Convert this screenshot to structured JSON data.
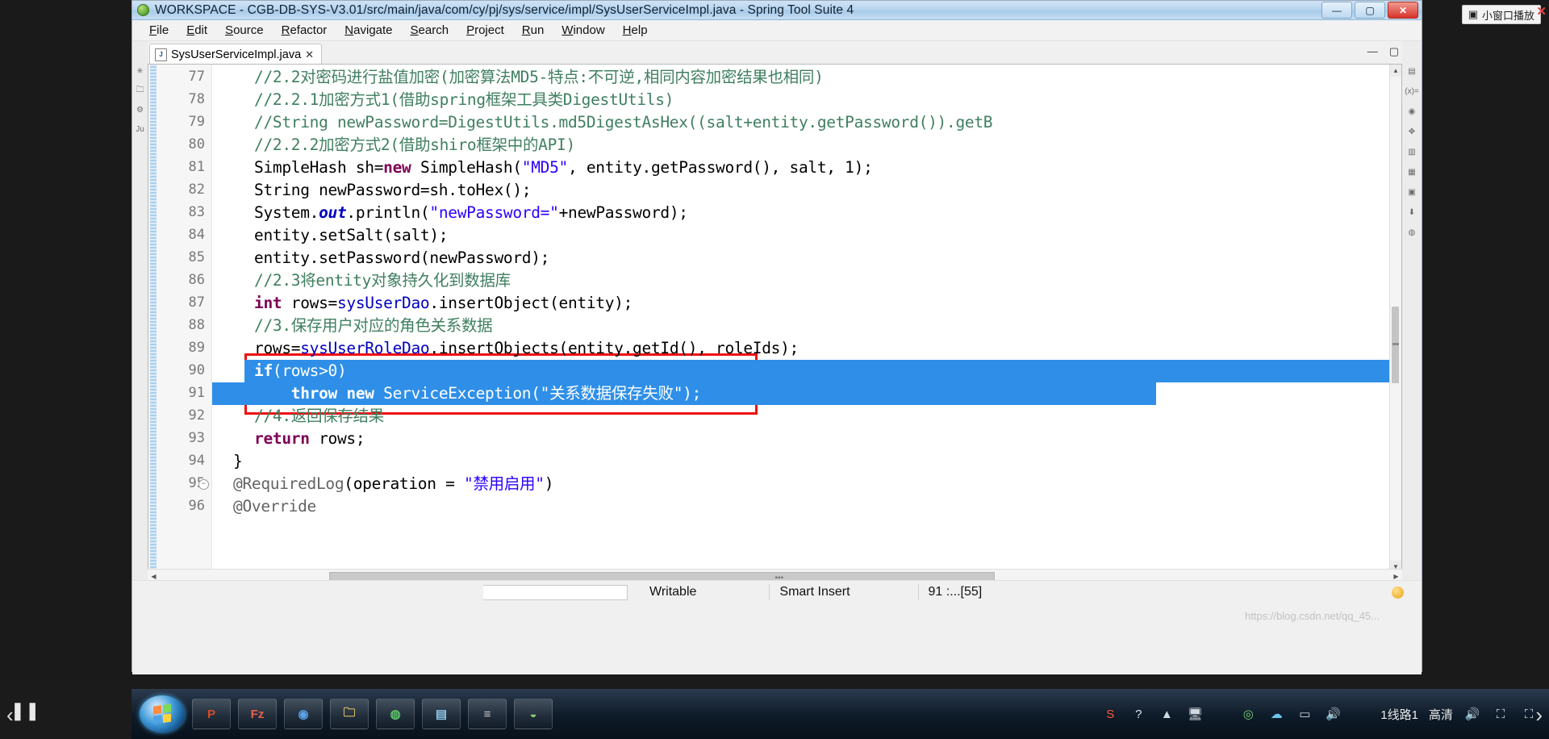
{
  "window": {
    "title": "WORKSPACE - CGB-DB-SYS-V3.01/src/main/java/com/cy/pj/sys/service/impl/SysUserServiceImpl.java - Spring Tool Suite 4",
    "minimize_label": "—",
    "maximize_label": "▢",
    "close_label": "✕"
  },
  "menu": {
    "items": [
      {
        "label": "File"
      },
      {
        "label": "Edit"
      },
      {
        "label": "Source"
      },
      {
        "label": "Refactor"
      },
      {
        "label": "Navigate"
      },
      {
        "label": "Search"
      },
      {
        "label": "Project"
      },
      {
        "label": "Run"
      },
      {
        "label": "Window"
      },
      {
        "label": "Help"
      }
    ]
  },
  "editor": {
    "tab": {
      "label": "SysUserServiceImpl.java",
      "icon": "java-file-icon",
      "icon_glyph": "J",
      "close_glyph": "✕"
    },
    "minimize_glyph": "—",
    "maximize_glyph": "▢",
    "first_line": 77,
    "lines": [
      {
        "no": "77",
        "tokens": [
          {
            "t": "//2.2对密码进行盐值加密(加密算法MD5-特点:不可逆,相同内容加密结果也相同)",
            "c": "cmt"
          }
        ]
      },
      {
        "no": "78",
        "tokens": [
          {
            "t": "//2.2.1加密方式1(借助spring框架工具类DigestUtils)",
            "c": "cmt"
          }
        ]
      },
      {
        "no": "79",
        "tokens": [
          {
            "t": "//String newPassword=DigestUtils.md5DigestAsHex((salt+entity.getPassword()).getB",
            "c": "cmt"
          }
        ]
      },
      {
        "no": "80",
        "tokens": [
          {
            "t": "//2.2.2加密方式2(借助shiro框架中的API)",
            "c": "cmt"
          }
        ]
      },
      {
        "no": "81",
        "tokens": [
          {
            "t": "SimpleHash sh=",
            "c": "plain"
          },
          {
            "t": "new",
            "c": "k"
          },
          {
            "t": " SimpleHash(",
            "c": "plain"
          },
          {
            "t": "\"MD5\"",
            "c": "str"
          },
          {
            "t": ", entity.getPassword(), salt, 1);",
            "c": "plain"
          }
        ]
      },
      {
        "no": "82",
        "tokens": [
          {
            "t": "String newPassword=sh.toHex();",
            "c": "plain"
          }
        ]
      },
      {
        "no": "83",
        "tokens": [
          {
            "t": "System.",
            "c": "plain"
          },
          {
            "t": "out",
            "c": "ital"
          },
          {
            "t": ".println(",
            "c": "plain"
          },
          {
            "t": "\"newPassword=\"",
            "c": "str"
          },
          {
            "t": "+newPassword);",
            "c": "plain"
          }
        ]
      },
      {
        "no": "84",
        "tokens": [
          {
            "t": "entity.setSalt(salt);",
            "c": "plain"
          }
        ]
      },
      {
        "no": "85",
        "tokens": [
          {
            "t": "entity.setPassword(newPassword);",
            "c": "plain"
          }
        ]
      },
      {
        "no": "86",
        "tokens": [
          {
            "t": "//2.3将entity对象持久化到数据库",
            "c": "cmt"
          }
        ]
      },
      {
        "no": "87",
        "tokens": [
          {
            "t": "int",
            "c": "k"
          },
          {
            "t": " rows=",
            "c": "plain"
          },
          {
            "t": "sysUserDao",
            "c": "fld"
          },
          {
            "t": ".insertObject(entity);",
            "c": "plain"
          }
        ]
      },
      {
        "no": "88",
        "tokens": [
          {
            "t": "//3.保存用户对应的角色关系数据",
            "c": "cmt"
          }
        ]
      },
      {
        "no": "89",
        "tokens": [
          {
            "t": "rows=",
            "c": "plain"
          },
          {
            "t": "sysUserRoleDao",
            "c": "fld"
          },
          {
            "t": ".insertObjects(entity.getId(), roleIds);",
            "c": "plain"
          }
        ]
      },
      {
        "no": "90",
        "selected": true,
        "tokens": [
          {
            "t": "if",
            "c": "onselk"
          },
          {
            "t": "(rows>0)",
            "c": "onsel"
          }
        ]
      },
      {
        "no": "91",
        "selected": true,
        "tokens": [
          {
            "t": "    throw new",
            "c": "onselk"
          },
          {
            "t": " ServiceException(",
            "c": "onsel"
          },
          {
            "t": "\"关系数据保存失败\"",
            "c": "onselstr"
          },
          {
            "t": ");",
            "c": "onsel"
          }
        ]
      },
      {
        "no": "92",
        "tokens": [
          {
            "t": "//4.返回保存结果",
            "c": "cmt"
          }
        ]
      },
      {
        "no": "93",
        "tokens": [
          {
            "t": "return",
            "c": "k"
          },
          {
            "t": " rows;",
            "c": "plain"
          }
        ]
      },
      {
        "no": "94",
        "tokens": [
          {
            "t": "}",
            "c": "plain"
          }
        ]
      },
      {
        "no": "95",
        "fold": true,
        "tokens": [
          {
            "t": "@RequiredLog",
            "c": "ann"
          },
          {
            "t": "(operation = ",
            "c": "plain"
          },
          {
            "t": "\"禁用启用\"",
            "c": "str"
          },
          {
            "t": ")",
            "c": "plain"
          }
        ]
      },
      {
        "no": "96",
        "tokens": [
          {
            "t": "@Override",
            "c": "ann"
          }
        ]
      }
    ],
    "colors": {
      "selection": "#2f8fe8",
      "comment": "#3f7f5f",
      "keyword": "#7f0055",
      "string": "#2a00ff",
      "field": "#0000c0",
      "annotation": "#646464",
      "annotation_box": "#ee1111"
    }
  },
  "status_bar": {
    "writable": "Writable",
    "insert_mode": "Smart Insert",
    "position": "91 :...[55]"
  },
  "left_toolbar": {
    "icons": [
      {
        "name": "outline-icon",
        "glyph": "✳"
      },
      {
        "name": "package-explorer-icon",
        "glyph": "🗀"
      },
      {
        "name": "hierarchy-icon",
        "glyph": "⚙"
      },
      {
        "name": "junit-icon",
        "glyph": "Ju"
      }
    ]
  },
  "right_toolbar": {
    "icons": [
      {
        "name": "properties-icon",
        "glyph": "▤"
      },
      {
        "name": "variables-icon",
        "glyph": "(x)="
      },
      {
        "name": "breakpoints-icon",
        "glyph": "◉"
      },
      {
        "name": "expressions-icon",
        "glyph": "✥"
      },
      {
        "name": "outline-view-icon",
        "glyph": "▥"
      },
      {
        "name": "task-list-icon",
        "glyph": "▦"
      },
      {
        "name": "console-icon",
        "glyph": "▣"
      },
      {
        "name": "boot-dashboard-icon",
        "glyph": "⬇"
      },
      {
        "name": "spring-icon",
        "glyph": "◍"
      }
    ]
  },
  "player": {
    "pause_glyph": "❚❚",
    "prev_glyph": "‹",
    "next_glyph": "›",
    "pip_label": "小窗口播放",
    "pip_icon": "pip-window-icon",
    "pip_close": "✕",
    "watermark": "https://blog.csdn.net/qq_45..."
  },
  "taskbar": {
    "start_icon": "windows-start-orb",
    "buttons": [
      {
        "name": "taskbar-item-ppt",
        "glyph": "P",
        "color": "#d64b2a"
      },
      {
        "name": "taskbar-item-editor",
        "glyph": "Fz",
        "color": "#e8604c"
      },
      {
        "name": "taskbar-item-chrome",
        "glyph": "◉",
        "color": "#5aa1e8"
      },
      {
        "name": "taskbar-item-explorer",
        "glyph": "🗀",
        "color": "#e9c46a"
      },
      {
        "name": "taskbar-item-browser",
        "glyph": "◍",
        "color": "#5fc46a"
      },
      {
        "name": "taskbar-item-db",
        "glyph": "▤",
        "color": "#8fc6e8"
      },
      {
        "name": "taskbar-item-sts",
        "glyph": "≡",
        "color": "#c9c9c9"
      },
      {
        "name": "taskbar-item-eclipse",
        "glyph": "◒",
        "color": "#8ed070"
      }
    ],
    "tray": {
      "sogou_glyph": "S",
      "help_glyph": "?",
      "arrow_glyph": "▲",
      "monitor_glyph": "🖥",
      "shield_glyph": "◎",
      "cloud_glyph": "☁",
      "battery_glyph": "▭",
      "volume_glyph": "🔊"
    },
    "overlay": {
      "line_label": "1线路1",
      "quality_label": "高清",
      "volume_glyph": "🔊",
      "fullscreen_glyph": "⛶",
      "expand_glyph": "⛶"
    }
  }
}
